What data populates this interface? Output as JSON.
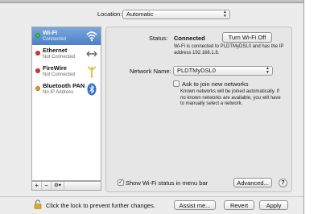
{
  "location": {
    "label": "Location:",
    "value": "Automatic"
  },
  "services": [
    {
      "name": "Wi-Fi",
      "status": "Connected",
      "dot_color": "#3ec23e",
      "icon": "wifi-icon",
      "selected": true
    },
    {
      "name": "Ethernet",
      "status": "Not Connected",
      "dot_color": "#d83a2e",
      "icon": "ethernet-arrows-icon",
      "selected": false
    },
    {
      "name": "FireWire",
      "status": "Not Connected",
      "dot_color": "#d83a2e",
      "icon": "firewire-icon",
      "selected": false
    },
    {
      "name": "Bluetooth PAN",
      "status": "No IP Address",
      "dot_color": "#e39a1f",
      "icon": "bluetooth-icon",
      "selected": false
    }
  ],
  "sidebar_tools": {
    "add": "+",
    "remove": "−",
    "gear": "⚙▾"
  },
  "detail": {
    "status_label": "Status:",
    "status_value": "Connected",
    "turn_off_button": "Turn Wi-Fi Off",
    "status_description": "Wi-Fi is connected to PLDTMyDSL0 and has the IP address 192.168.1.8.",
    "network_name_label": "Network Name:",
    "network_name_value": "PLDTMyDSL0",
    "ask_join_label": "Ask to join new networks",
    "ask_join_checked": false,
    "ask_join_description": "Known networks will be joined automatically. If no known networks are available, you will have to manually select a network.",
    "show_status_label": "Show Wi-Fi status in menu bar",
    "show_status_checked": true,
    "advanced_button": "Advanced...",
    "help_button": "?"
  },
  "footer": {
    "lock_text": "Click the lock to prevent further changes.",
    "assist_button": "Assist me...",
    "revert_button": "Revert",
    "apply_button": "Apply"
  },
  "colors": {
    "selection": "#5b8fd2",
    "window_bg": "#ececec"
  }
}
